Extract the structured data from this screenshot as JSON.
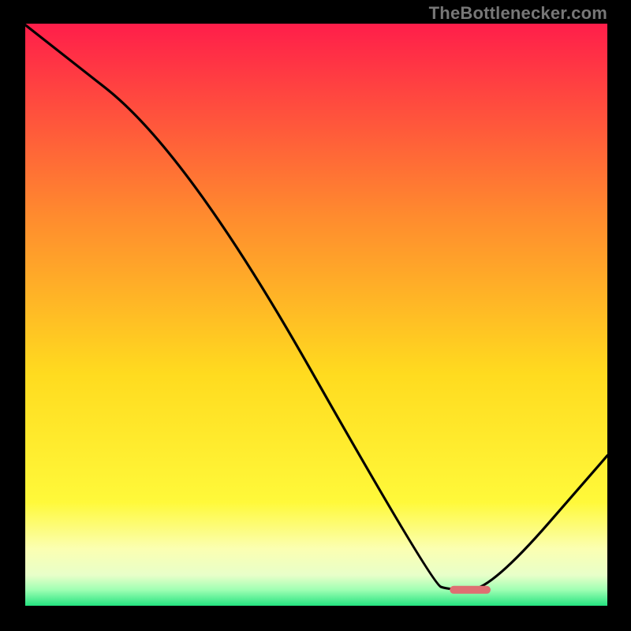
{
  "watermark": "TheBottlenecker.com",
  "chart_data": {
    "type": "line",
    "title": "",
    "xlabel": "",
    "ylabel": "",
    "xlim": [
      0,
      100
    ],
    "ylim": [
      0,
      100
    ],
    "grid": false,
    "series": [
      {
        "name": "curve",
        "x": [
          0,
          28,
          70,
          73,
          80,
          100
        ],
        "values": [
          100,
          78,
          4,
          3,
          3,
          26
        ]
      }
    ],
    "marker": {
      "x_start": 73,
      "x_end": 80,
      "y": 3,
      "color": "#de6f72"
    },
    "background_gradient": [
      {
        "offset": 0.0,
        "color": "#ff1e4a"
      },
      {
        "offset": 0.33,
        "color": "#ff8b2e"
      },
      {
        "offset": 0.6,
        "color": "#ffdb1f"
      },
      {
        "offset": 0.82,
        "color": "#fff93a"
      },
      {
        "offset": 0.9,
        "color": "#fbffb2"
      },
      {
        "offset": 0.945,
        "color": "#e8ffc9"
      },
      {
        "offset": 0.97,
        "color": "#9fffb3"
      },
      {
        "offset": 1.0,
        "color": "#18e07b"
      }
    ]
  }
}
